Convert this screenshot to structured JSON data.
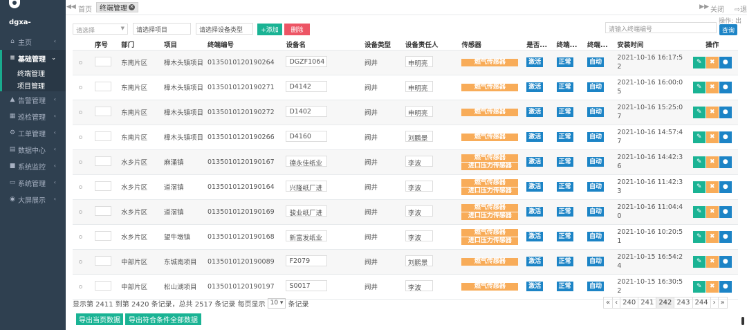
{
  "user": {
    "name": "dgxa-"
  },
  "sidebar": {
    "items": [
      {
        "icon": "home-icon",
        "glyph": "⌂",
        "label": "主页"
      },
      {
        "icon": "list-icon",
        "glyph": "≡",
        "label": "基础管理",
        "expanded": true
      },
      {
        "icon": "warning-icon",
        "glyph": "▲",
        "label": "告警管理"
      },
      {
        "icon": "calendar-icon",
        "glyph": "▦",
        "label": "巡检管理"
      },
      {
        "icon": "cogs-icon",
        "glyph": "⚙",
        "label": "工单管理"
      },
      {
        "icon": "database-icon",
        "glyph": "▤",
        "label": "数据中心"
      },
      {
        "icon": "video-icon",
        "glyph": "■",
        "label": "系统监控"
      },
      {
        "icon": "desktop-icon",
        "glyph": "▭",
        "label": "系统管理"
      },
      {
        "icon": "dashboard-icon",
        "glyph": "◉",
        "label": "大屏展示"
      }
    ],
    "subitems": [
      "终端管理",
      "项目管理"
    ]
  },
  "tabs": {
    "back": "◀◀",
    "home": "首页",
    "active": "终端管理",
    "forward": "▶▶",
    "close": "关闭",
    "exit": "⇨退"
  },
  "toolbar": {
    "select_placeholder": "请选择",
    "project_placeholder": "请选择项目",
    "device_type_placeholder": "请选择设备类型",
    "add_label": "+添加",
    "delete_label": "删除",
    "search_placeholder": "请输入终端编号",
    "ops_label": "操作: 出",
    "query_label": "查询"
  },
  "table": {
    "headers": [
      "",
      "序号",
      "部门",
      "项目",
      "终端编号",
      "设备名",
      "设备类型",
      "设备责任人",
      "传感器",
      "是否...",
      "终端...",
      "终端...",
      "安装时间",
      "操作"
    ],
    "rows": [
      {
        "dept": "东南片区",
        "project": "樟木头镇项目",
        "code": "0135010120190264",
        "name": "DGZF1064",
        "type": "阀井",
        "person": "申明亮",
        "sensors": [
          "燃气传感器"
        ],
        "activated": "激活",
        "status": "正常",
        "mode": "自动",
        "time": "2021-10-16 16:17:52"
      },
      {
        "dept": "东南片区",
        "project": "樟木头镇项目",
        "code": "0135010120190271",
        "name": "D4142",
        "type": "阀井",
        "person": "申明亮",
        "sensors": [
          "燃气传感器"
        ],
        "activated": "激活",
        "status": "正常",
        "mode": "自动",
        "time": "2021-10-16 16:00:05"
      },
      {
        "dept": "东南片区",
        "project": "樟木头镇项目",
        "code": "0135010120190272",
        "name": "D1402",
        "type": "阀井",
        "person": "申明亮",
        "sensors": [
          "燃气传感器"
        ],
        "activated": "激活",
        "status": "正常",
        "mode": "自动",
        "time": "2021-10-16 15:25:07"
      },
      {
        "dept": "东南片区",
        "project": "樟木头镇项目",
        "code": "0135010120190266",
        "name": "D4160",
        "type": "阀井",
        "person": "刘鹏景",
        "sensors": [
          "燃气传感器"
        ],
        "activated": "激活",
        "status": "正常",
        "mode": "自动",
        "time": "2021-10-16 14:57:47"
      },
      {
        "dept": "水乡片区",
        "project": "麻涌镇",
        "code": "0135010120190167",
        "name": "德永佳纸业",
        "type": "阀井",
        "person": "李波",
        "sensors": [
          "燃气传感器",
          "进口压力传感器"
        ],
        "activated": "激活",
        "status": "正常",
        "mode": "自动",
        "time": "2021-10-16 14:42:36"
      },
      {
        "dept": "水乡片区",
        "project": "道滘镇",
        "code": "0135010120190164",
        "name": "兴隆纸厂进",
        "type": "阀井",
        "person": "李波",
        "sensors": [
          "燃气传感器",
          "进口压力传感器"
        ],
        "activated": "激活",
        "status": "正常",
        "mode": "自动",
        "time": "2021-10-16 11:42:33"
      },
      {
        "dept": "水乡片区",
        "project": "道滘镇",
        "code": "0135010120190169",
        "name": "骏业纸厂进",
        "type": "阀井",
        "person": "李波",
        "sensors": [
          "燃气传感器",
          "进口压力传感器"
        ],
        "activated": "激活",
        "status": "正常",
        "mode": "自动",
        "time": "2021-10-16 11:04:40"
      },
      {
        "dept": "水乡片区",
        "project": "望牛墩镇",
        "code": "0135010120190168",
        "name": "新富发纸业",
        "type": "阀井",
        "person": "李波",
        "sensors": [
          "燃气传感器",
          "进口压力传感器"
        ],
        "activated": "激活",
        "status": "正常",
        "mode": "自动",
        "time": "2021-10-16 10:20:51"
      },
      {
        "dept": "中部片区",
        "project": "东城南项目",
        "code": "0135010120190089",
        "name": "F2079",
        "type": "阀井",
        "person": "刘鹏景",
        "sensors": [
          "燃气传感器"
        ],
        "activated": "激活",
        "status": "正常",
        "mode": "自动",
        "time": "2021-10-15 16:54:24"
      },
      {
        "dept": "中部片区",
        "project": "松山湖项目",
        "code": "0135010120190197",
        "name": "S0017",
        "type": "阀井",
        "person": "李波",
        "sensors": [
          "燃气传感器"
        ],
        "activated": "激活",
        "status": "正常",
        "mode": "自动",
        "time": "2021-10-15 16:30:52"
      }
    ]
  },
  "ops": {
    "edit": "✎",
    "delete": "✖",
    "view": "●"
  },
  "footer": {
    "info_prefix": "显示第 2411 到第 2420 条记录，总共 2517 条记录 每页显示",
    "page_size": "10 ▾",
    "info_suffix": "条记录",
    "pages": [
      "«",
      "‹",
      "240",
      "241",
      "242",
      "243",
      "244",
      "›",
      "»"
    ],
    "current_page": "242",
    "export_page": "导出当页数据",
    "export_all": "导出符合条件全部数据"
  },
  "colors": {
    "sidebar": "#2f4050",
    "primary": "#1ab394",
    "danger": "#ed5565",
    "info": "#1c84c6",
    "warning": "#f8ac59"
  }
}
